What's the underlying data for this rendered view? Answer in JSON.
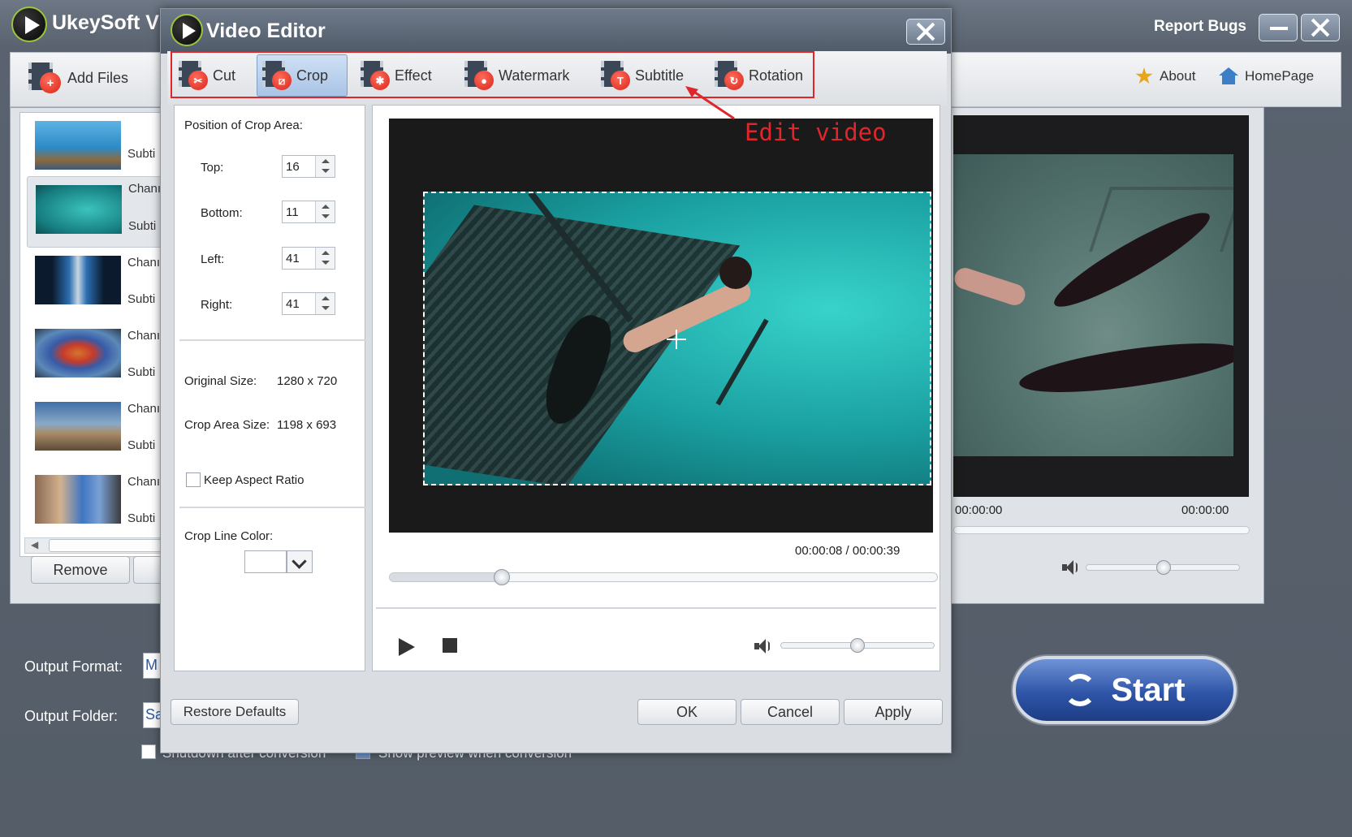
{
  "main_window": {
    "title": "UkeySoft Vi",
    "report_bugs": "Report Bugs",
    "toolbar": {
      "add_files": "Add Files",
      "about": "About",
      "homepage": "HomePage"
    },
    "file_list": {
      "items": [
        {
          "line1": "Subti",
          "line2": ""
        },
        {
          "line1": "Chanı",
          "line2": "Subti"
        },
        {
          "line1": "Chanı",
          "line2": "Subti"
        },
        {
          "line1": "Chanı",
          "line2": "Subti"
        },
        {
          "line1": "Chanı",
          "line2": "Subti"
        },
        {
          "line1": "Chanı",
          "line2": "Subti"
        }
      ],
      "remove_label": "Remove"
    },
    "preview": {
      "time_current": "00:00:00",
      "time_total": "00:00:00",
      "volume_level": 0.5
    },
    "output_format_label": "Output Format:",
    "output_format_value": "M",
    "output_folder_label": "Output Folder:",
    "output_folder_value": "Sa",
    "shutdown_label": "Shutdown after conversion",
    "show_preview_label": "Show preview when conversion",
    "start_label": "Start"
  },
  "dialog": {
    "title": "Video Editor",
    "tabs": [
      {
        "label": "Cut",
        "icon": "scissors-icon"
      },
      {
        "label": "Crop",
        "icon": "crop-icon"
      },
      {
        "label": "Effect",
        "icon": "magic-wand-icon"
      },
      {
        "label": "Watermark",
        "icon": "droplet-icon"
      },
      {
        "label": "Subtitle",
        "icon": "text-t-icon"
      },
      {
        "label": "Rotation",
        "icon": "rotate-icon"
      }
    ],
    "active_tab": "Crop",
    "crop": {
      "section_title": "Position of Crop Area:",
      "top_label": "Top:",
      "top_value": "16",
      "bottom_label": "Bottom:",
      "bottom_value": "11",
      "left_label": "Left:",
      "left_value": "41",
      "right_label": "Right:",
      "right_value": "41",
      "original_size_label": "Original Size:",
      "original_size_value": "1280 x 720",
      "crop_area_size_label": "Crop Area Size:",
      "crop_area_size_value": "1198 x 693",
      "keep_aspect_label": "Keep Aspect Ratio",
      "crop_line_color_label": "Crop Line Color:",
      "crop_line_color": "#ffffff"
    },
    "player": {
      "time": "00:00:08  /  00:00:39",
      "seek_progress": 0.205,
      "volume_level": 0.5
    },
    "buttons": {
      "restore": "Restore Defaults",
      "ok": "OK",
      "cancel": "Cancel",
      "apply": "Apply"
    }
  },
  "annotation": {
    "text": "Edit video",
    "color": "#e0262b"
  }
}
